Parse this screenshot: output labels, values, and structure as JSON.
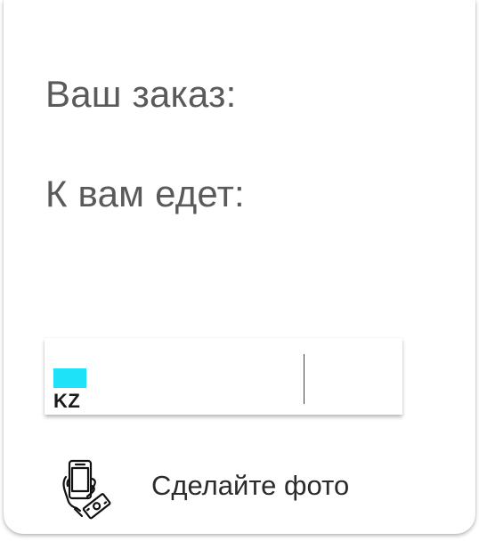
{
  "order": {
    "label": "Ваш заказ:",
    "value": ""
  },
  "courier": {
    "label": "К вам едет:",
    "value": ""
  },
  "plate": {
    "country_code": "KZ",
    "flag_color": "#1ee3f8",
    "number": "",
    "region": ""
  },
  "photo_action": {
    "label": "Сделайте фото",
    "icon": "phone-in-hand-with-money-icon"
  }
}
